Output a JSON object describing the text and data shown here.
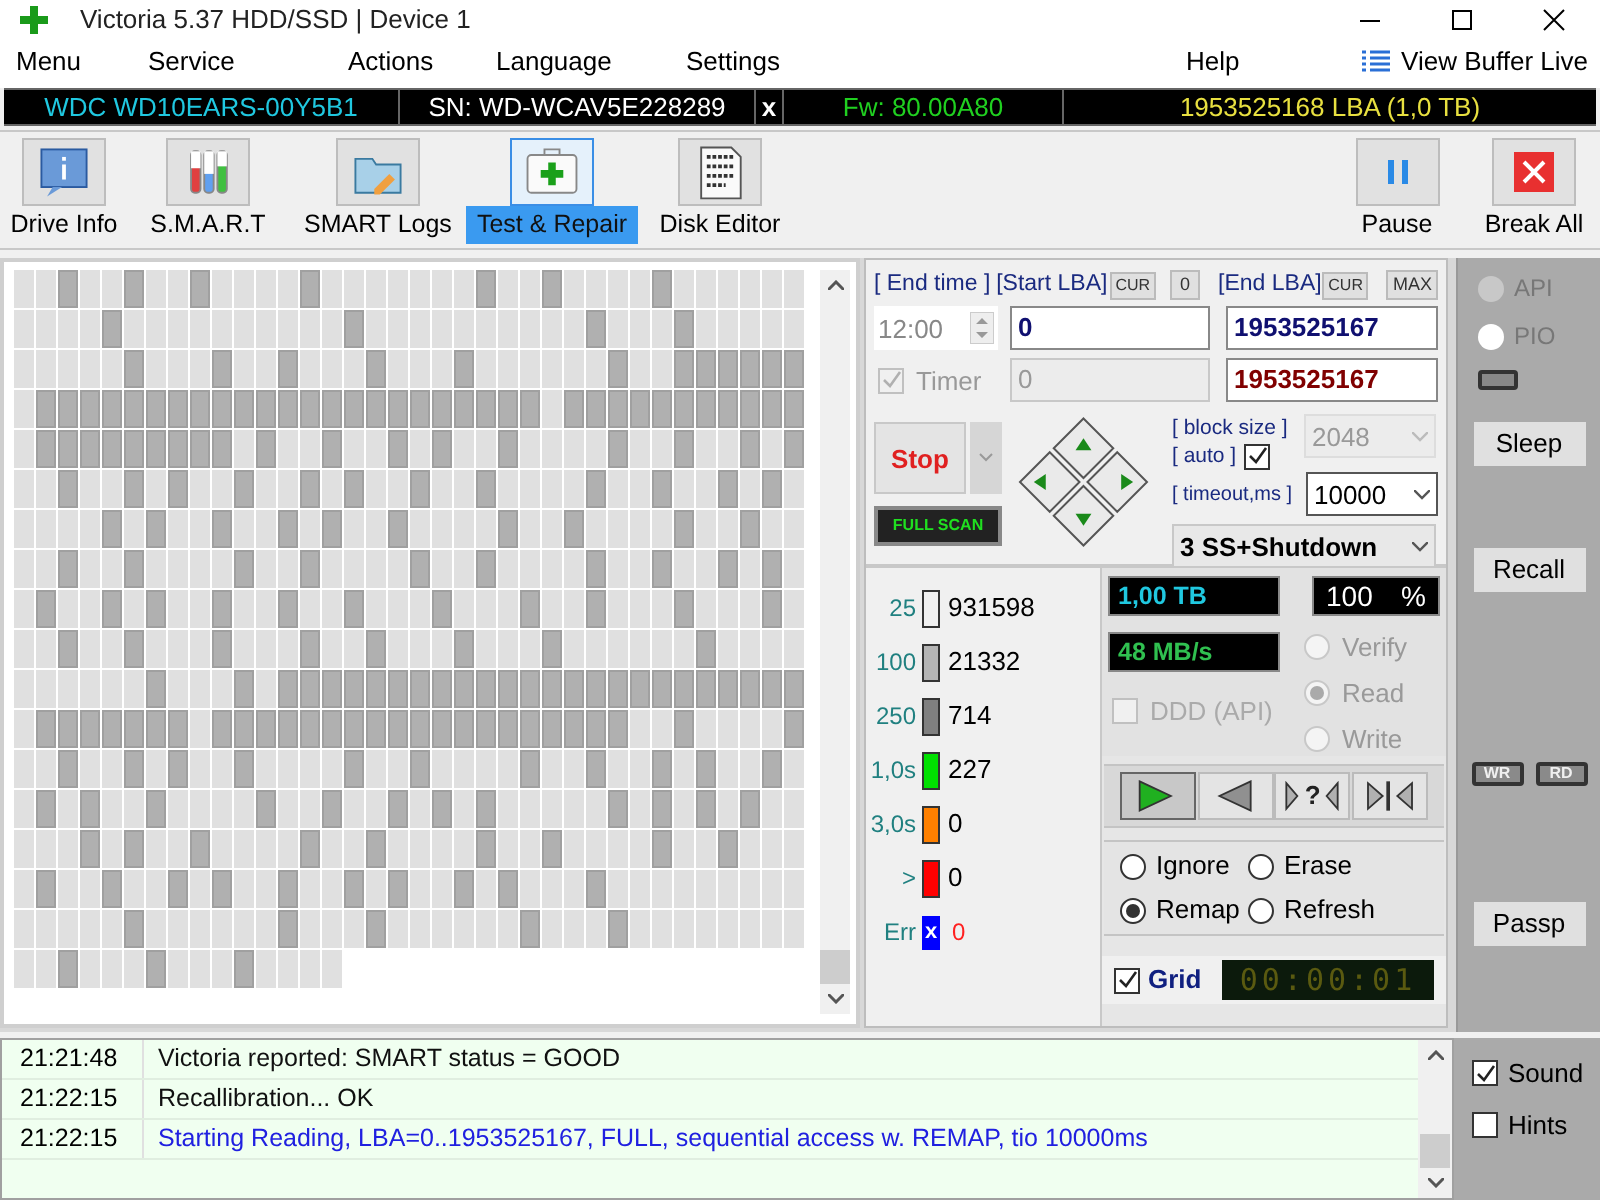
{
  "window": {
    "title": "Victoria 5.37 HDD/SSD | Device 1"
  },
  "menu": [
    {
      "label": "Menu"
    },
    {
      "label": "Service"
    },
    {
      "label": "Actions"
    },
    {
      "label": "Language"
    },
    {
      "label": "Settings"
    },
    {
      "label": "Help"
    }
  ],
  "view_buffer": "View Buffer Live",
  "drive_bar": {
    "model": "WDC WD10EARS-00Y5B1",
    "serial": "SN: WD-WCAV5E228289",
    "close": "x",
    "firmware": "Fw: 80.00A80",
    "capacity": "1953525168 LBA (1,0 TB)"
  },
  "toolbar": [
    {
      "label": "Drive Info",
      "selected": false
    },
    {
      "label": "S.M.A.R.T",
      "selected": false
    },
    {
      "label": "SMART Logs",
      "selected": false
    },
    {
      "label": "Test & Repair",
      "selected": true
    },
    {
      "label": "Disk Editor",
      "selected": false
    }
  ],
  "toolbar_right": [
    {
      "label": "Pause"
    },
    {
      "label": "Break All"
    }
  ],
  "scan_grid": {
    "rows": [
      [
        false,
        false,
        true,
        false,
        false,
        true,
        false,
        false,
        true,
        false,
        false,
        false,
        false,
        true,
        false,
        false,
        false,
        false,
        false,
        false,
        false,
        true,
        false,
        false,
        true,
        false,
        false,
        false,
        false,
        true,
        false,
        false,
        false,
        false,
        false,
        false
      ],
      [
        false,
        false,
        false,
        false,
        true,
        false,
        false,
        false,
        false,
        false,
        false,
        false,
        false,
        false,
        false,
        true,
        false,
        false,
        false,
        false,
        false,
        false,
        false,
        false,
        false,
        false,
        true,
        false,
        false,
        false,
        true,
        false,
        false,
        false,
        false,
        false
      ],
      [
        false,
        false,
        false,
        false,
        false,
        true,
        false,
        false,
        false,
        true,
        false,
        false,
        true,
        false,
        false,
        false,
        true,
        false,
        false,
        false,
        true,
        false,
        false,
        false,
        false,
        false,
        false,
        true,
        false,
        false,
        true,
        true,
        true,
        true,
        true,
        true
      ],
      [
        false,
        true,
        true,
        true,
        true,
        true,
        true,
        true,
        true,
        true,
        true,
        true,
        true,
        true,
        true,
        true,
        true,
        true,
        true,
        true,
        true,
        true,
        true,
        true,
        false,
        true,
        true,
        true,
        true,
        true,
        true,
        true,
        true,
        true,
        true,
        true
      ],
      [
        false,
        true,
        true,
        true,
        true,
        true,
        true,
        true,
        true,
        true,
        false,
        true,
        false,
        false,
        true,
        false,
        false,
        true,
        false,
        true,
        false,
        false,
        true,
        false,
        false,
        false,
        false,
        true,
        false,
        false,
        true,
        false,
        false,
        true,
        false,
        true
      ],
      [
        false,
        false,
        true,
        false,
        false,
        true,
        false,
        true,
        false,
        false,
        true,
        false,
        false,
        true,
        false,
        true,
        false,
        false,
        true,
        false,
        false,
        true,
        false,
        false,
        false,
        false,
        true,
        false,
        false,
        true,
        false,
        false,
        true,
        false,
        true,
        false
      ],
      [
        false,
        false,
        false,
        false,
        true,
        false,
        true,
        false,
        false,
        true,
        false,
        false,
        true,
        false,
        true,
        false,
        false,
        true,
        false,
        false,
        false,
        false,
        true,
        false,
        false,
        true,
        false,
        false,
        false,
        false,
        true,
        false,
        false,
        true,
        false,
        false
      ],
      [
        false,
        false,
        true,
        false,
        false,
        true,
        false,
        false,
        false,
        false,
        true,
        false,
        false,
        true,
        false,
        false,
        false,
        false,
        true,
        false,
        false,
        true,
        false,
        false,
        false,
        false,
        true,
        false,
        false,
        true,
        false,
        false,
        true,
        false,
        true,
        false
      ],
      [
        false,
        true,
        false,
        false,
        true,
        false,
        true,
        false,
        false,
        true,
        false,
        false,
        true,
        false,
        false,
        true,
        false,
        false,
        false,
        true,
        false,
        false,
        false,
        true,
        false,
        false,
        true,
        false,
        false,
        false,
        true,
        false,
        false,
        false,
        true,
        false
      ],
      [
        false,
        false,
        true,
        false,
        false,
        true,
        false,
        false,
        false,
        true,
        false,
        false,
        false,
        true,
        false,
        false,
        true,
        false,
        false,
        false,
        true,
        false,
        false,
        false,
        true,
        false,
        false,
        false,
        false,
        false,
        false,
        true,
        false,
        false,
        false,
        false
      ],
      [
        false,
        false,
        false,
        false,
        false,
        false,
        true,
        false,
        false,
        false,
        true,
        false,
        true,
        true,
        true,
        true,
        true,
        true,
        true,
        true,
        true,
        true,
        true,
        true,
        true,
        true,
        true,
        true,
        true,
        true,
        true,
        true,
        true,
        true,
        true,
        true
      ],
      [
        false,
        true,
        true,
        true,
        true,
        true,
        true,
        true,
        false,
        true,
        true,
        true,
        true,
        true,
        true,
        true,
        true,
        true,
        true,
        true,
        true,
        true,
        true,
        true,
        true,
        true,
        true,
        true,
        false,
        false,
        true,
        false,
        false,
        false,
        false,
        true
      ],
      [
        false,
        false,
        true,
        false,
        false,
        true,
        false,
        true,
        false,
        false,
        true,
        false,
        false,
        false,
        false,
        true,
        false,
        false,
        true,
        false,
        false,
        false,
        false,
        true,
        false,
        false,
        true,
        false,
        false,
        true,
        false,
        true,
        false,
        false,
        true,
        false
      ],
      [
        false,
        true,
        false,
        true,
        false,
        false,
        true,
        false,
        false,
        false,
        false,
        true,
        false,
        false,
        true,
        false,
        false,
        true,
        false,
        true,
        false,
        true,
        false,
        false,
        false,
        false,
        false,
        true,
        false,
        true,
        false,
        true,
        false,
        true,
        false,
        false
      ],
      [
        false,
        false,
        false,
        true,
        false,
        true,
        false,
        false,
        true,
        false,
        false,
        false,
        false,
        true,
        false,
        false,
        true,
        false,
        false,
        false,
        false,
        true,
        false,
        false,
        true,
        false,
        false,
        false,
        false,
        true,
        false,
        false,
        true,
        false,
        false,
        false
      ],
      [
        false,
        true,
        false,
        false,
        true,
        false,
        false,
        true,
        false,
        true,
        false,
        false,
        true,
        false,
        false,
        true,
        false,
        true,
        false,
        false,
        true,
        false,
        true,
        false,
        false,
        false,
        true,
        false,
        false,
        false,
        false,
        false,
        false,
        false,
        false,
        false
      ],
      [
        false,
        false,
        false,
        false,
        false,
        true,
        false,
        false,
        false,
        false,
        false,
        false,
        true,
        false,
        false,
        false,
        true,
        false,
        false,
        false,
        false,
        false,
        false,
        true,
        false,
        false,
        false,
        true,
        false,
        false,
        false,
        false,
        false,
        false,
        false,
        false
      ],
      [
        false,
        false,
        true,
        false,
        false,
        false,
        true,
        false,
        false,
        false,
        true,
        false,
        false,
        false,
        false
      ]
    ]
  },
  "range": {
    "end_time_label": "[ End time ]",
    "end_time": "12:00",
    "start_lba_label": "[Start LBA]",
    "start_cur": "CUR",
    "start_zero": "0",
    "end_lba_label": "[End LBA]",
    "end_cur": "CUR",
    "end_max": "MAX",
    "start_lba": "0",
    "end_lba": "1953525167",
    "timer": {
      "label": "Timer",
      "checked": true
    },
    "start_lba_2": "0",
    "end_lba_2": "1953525167"
  },
  "controls": {
    "stop": "Stop",
    "full_scan": "FULL SCAN",
    "block_size_label": "[ block size ]",
    "block_size": "2048",
    "auto_label": "[ auto ]",
    "auto_checked": true,
    "timeout_label": "[ timeout,ms ]",
    "timeout": "10000",
    "action": "3 SS+Shutdown"
  },
  "legend": [
    {
      "kind": "range",
      "label": "25",
      "count": "931598",
      "color": "#f0f0f0"
    },
    {
      "kind": "range",
      "label": "100",
      "count": "21332",
      "color": "#b4b4b4"
    },
    {
      "kind": "range",
      "label": "250",
      "count": "714",
      "color": "#808080"
    },
    {
      "kind": "range",
      "label": "1,0s",
      "count": "227",
      "color": "#00e000"
    },
    {
      "kind": "range",
      "label": "3,0s",
      "count": "0",
      "color": "#ff8000"
    },
    {
      "kind": "range",
      "label": ">",
      "count": "0",
      "color": "#ff0000"
    },
    {
      "kind": "error",
      "label": "Err",
      "mark": "x",
      "count": "0",
      "color": "#0000ff"
    }
  ],
  "readouts": {
    "size": "1,00 TB",
    "percent": "100",
    "percent_unit": "%",
    "speed": "48 MB/s"
  },
  "mode": [
    {
      "label": "Verify",
      "selected": false
    },
    {
      "label": "Read",
      "selected": true
    },
    {
      "label": "Write",
      "selected": false
    }
  ],
  "ddd": {
    "label": "DDD (API)",
    "checked": false
  },
  "playback": [
    {
      "kind": "forward",
      "selected": true
    },
    {
      "kind": "backward",
      "selected": false
    },
    {
      "kind": "butterfly",
      "text": "?",
      "selected": false
    },
    {
      "kind": "jump",
      "selected": false
    }
  ],
  "error_action": [
    {
      "label": "Ignore",
      "selected": false
    },
    {
      "label": "Erase",
      "selected": false
    },
    {
      "label": "Remap",
      "selected": true
    },
    {
      "label": "Refresh",
      "selected": false
    }
  ],
  "grid_toggle": {
    "label": "Grid",
    "checked": true
  },
  "elapsed": "00:00:01",
  "side": {
    "interface": [
      {
        "label": "API",
        "selected": false
      },
      {
        "label": "PIO",
        "selected": false
      }
    ],
    "buttons": [
      {
        "label": "Sleep"
      },
      {
        "label": "Recall"
      }
    ],
    "indicators": [
      {
        "label": "WR"
      },
      {
        "label": "RD"
      }
    ],
    "passp": "Passp"
  },
  "log": [
    {
      "kind": "info",
      "time": "21:21:48",
      "message": "Victoria reported: SMART status = GOOD"
    },
    {
      "kind": "info",
      "time": "21:22:15",
      "message": "Recallibration... OK"
    },
    {
      "kind": "start",
      "time": "21:22:15",
      "message": "Starting Reading, LBA=0..1953525167, FULL, sequential access w. REMAP, tio 10000ms"
    }
  ],
  "options": [
    {
      "label": "Sound",
      "checked": true
    },
    {
      "label": "Hints",
      "checked": false
    }
  ]
}
